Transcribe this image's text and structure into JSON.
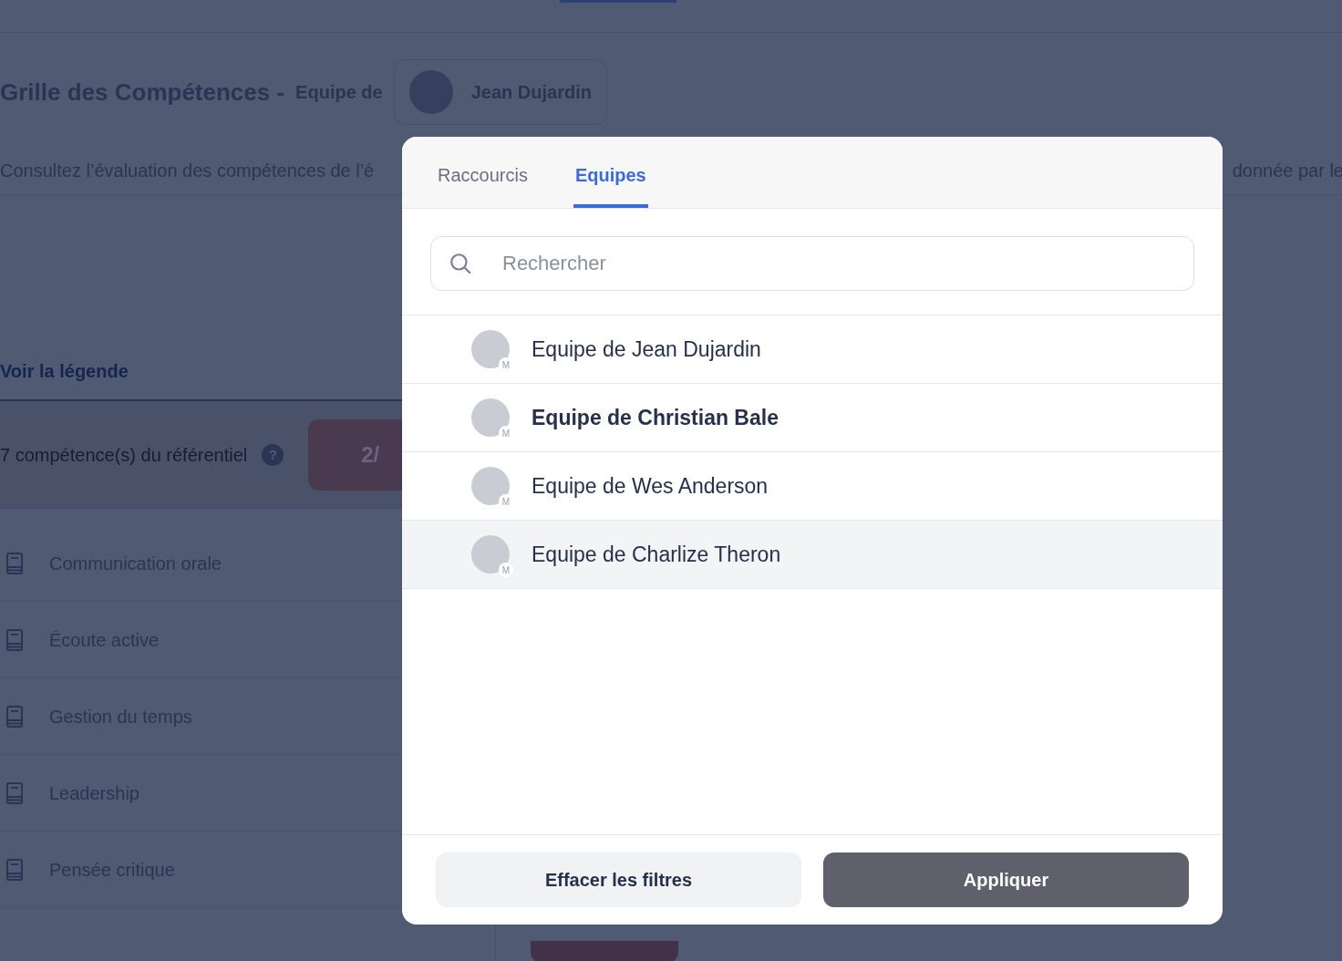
{
  "page": {
    "title": "Grille des Compétences -",
    "team_prefix": "Equipe de",
    "manager": "Jean Dujardin",
    "intro_left": "Consultez l’évaluation des compétences de l’é",
    "intro_right": "donnée par le",
    "legend_link": "Voir la légende",
    "summary": "7 compétence(s) du référentiel",
    "help": "?",
    "score": "2/",
    "skills": [
      "Communication orale",
      "Écoute active",
      "Gestion du temps",
      "Leadership",
      "Pensée critique"
    ]
  },
  "dialog": {
    "tabs": [
      {
        "label": "Raccourcis",
        "selected": false
      },
      {
        "label": "Equipes",
        "selected": true
      }
    ],
    "search": {
      "placeholder": "Rechercher"
    },
    "teams": [
      {
        "label": "Equipe de Jean Dujardin",
        "badge": "M",
        "selected": false,
        "highlighted": false
      },
      {
        "label": "Equipe de Christian Bale",
        "badge": "M",
        "selected": true,
        "highlighted": false
      },
      {
        "label": "Equipe de Wes Anderson",
        "badge": "M",
        "selected": false,
        "highlighted": false
      },
      {
        "label": "Equipe de Charlize Theron",
        "badge": "M",
        "selected": false,
        "highlighted": true
      }
    ],
    "buttons": {
      "clear": "Effacer les filtres",
      "apply": "Appliquer"
    }
  }
}
